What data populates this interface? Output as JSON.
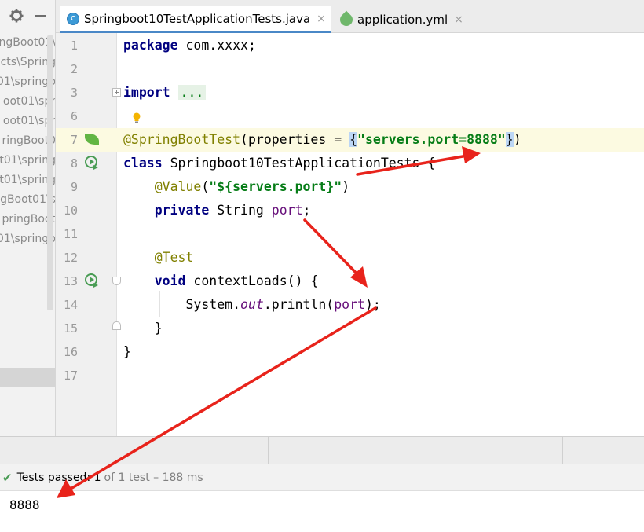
{
  "project_panel": {
    "tree_items": [
      "ngBoot01\\",
      "cts\\Spring",
      "01\\springb",
      "oot01\\spr",
      "oot01\\spr",
      "ringBoot0",
      "ot01\\spring",
      "t01\\spring",
      "gBoot01\\s",
      "pringBoot",
      "01\\springb"
    ]
  },
  "tabs": [
    {
      "label": "Springboot10TestApplicationTests.java",
      "icon": "java-class-icon",
      "active": true,
      "close": "×"
    },
    {
      "label": "application.yml",
      "icon": "spring-yml-icon",
      "active": false,
      "close": "×"
    }
  ],
  "editor": {
    "line_numbers": [
      "1",
      "2",
      "3",
      "6",
      "7",
      "8",
      "9",
      "10",
      "11",
      "12",
      "13",
      "14",
      "15",
      "16",
      "17"
    ],
    "lines": {
      "l1_kw": "package",
      "l1_rest": " com.xxxx;",
      "l3_kw": "import",
      "l3_fold": "...",
      "l7_ann": "@SpringBootTest",
      "l7_a": "(properties = ",
      "l7_open": "{",
      "l7_str": "\"servers.port=8888\"",
      "l7_close": "}",
      "l7_end": ")",
      "l8_kw": "class",
      "l8_rest": " Springboot10TestApplicationTests {",
      "l9_ann": "@Value",
      "l9_a": "(",
      "l9_str": "\"${servers.port}\"",
      "l9_end": ")",
      "l10_kw": "private",
      "l10_a": " String ",
      "l10_fld": "port",
      "l10_end": ";",
      "l12_ann": "@Test",
      "l13_kw": "void",
      "l13_rest": " contextLoads() {",
      "l14_a": "System.",
      "l14_static": "out",
      "l14_b": ".println(",
      "l14_fld": "port",
      "l14_end": ");",
      "l15": "}",
      "l16": "}"
    }
  },
  "status": {
    "check": "✔",
    "text": "Tests passed: 1",
    "rest": "of 1 test – 188 ms"
  },
  "console": {
    "output": "8888"
  },
  "colors": {
    "keyword": "#000080",
    "annotation": "#808000",
    "string": "#067d17",
    "field": "#660e7a",
    "arrow": "#e8231b",
    "pass": "#499c54"
  }
}
